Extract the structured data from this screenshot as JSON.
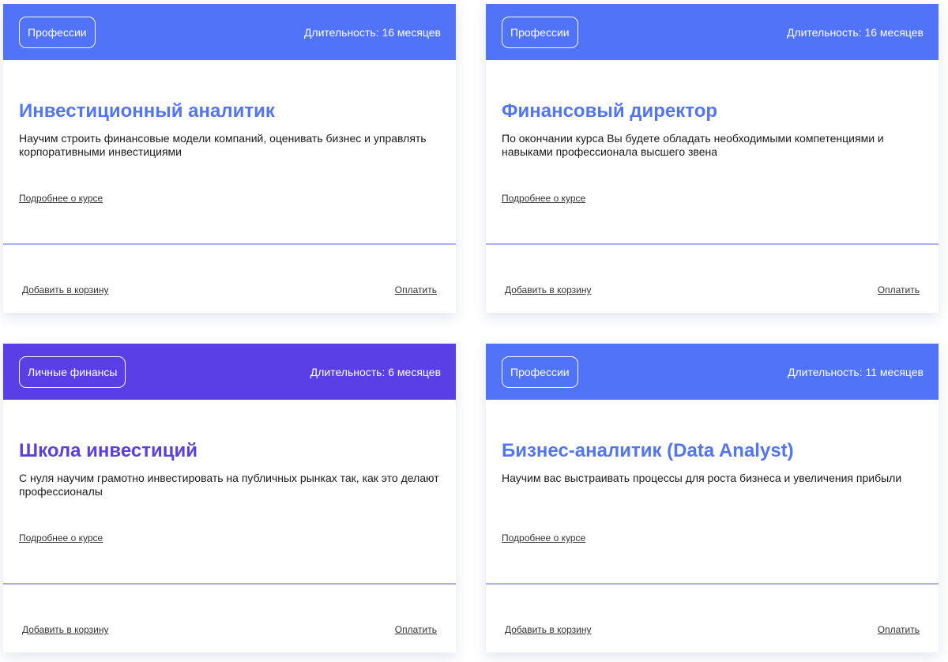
{
  "colors": {
    "header_blue": "#5173f7",
    "header_violet": "#5a3fe6",
    "title_blue": "#5175f3",
    "title_violet": "#5a3fe0",
    "divider": "#a9b4ee"
  },
  "cards": [
    {
      "tag": "Профессии",
      "duration": "Длительность: 16 месяцев",
      "title": "Инвестиционный аналитик",
      "description": "Научим строить финансовые модели компаний, оценивать бизнес и управлять корпоративными инвестициями",
      "more_link": "Подробнее о курсе",
      "cart_link": "Добавить в корзину",
      "pay_link": "Оплатить"
    },
    {
      "tag": "Профессии",
      "duration": "Длительность: 16 месяцев",
      "title": "Финансовый директор",
      "description": "По окончании курса Вы будете обладать необходимыми компетенциями и навыками профессионала высшего звена",
      "more_link": "Подробнее о курсе",
      "cart_link": "Добавить в корзину",
      "pay_link": "Оплатить"
    },
    {
      "tag": "Личные финансы",
      "duration": "Длительность: 6 месяцев",
      "title": "Школа инвестиций",
      "description": "С нуля научим грамотно инвестировать на публичных рынках так, как это делают профессионалы",
      "more_link": "Подробнее о курсе",
      "cart_link": "Добавить в корзину",
      "pay_link": "Оплатить"
    },
    {
      "tag": "Профессии",
      "duration": "Длительность: 11 месяцев",
      "title": "Бизнес-аналитик (Data Analyst)",
      "description": "Научим вас выстраивать процессы для роста бизнеса и увеличения прибыли",
      "more_link": "Подробнее о курсе",
      "cart_link": "Добавить в корзину",
      "pay_link": "Оплатить"
    }
  ]
}
